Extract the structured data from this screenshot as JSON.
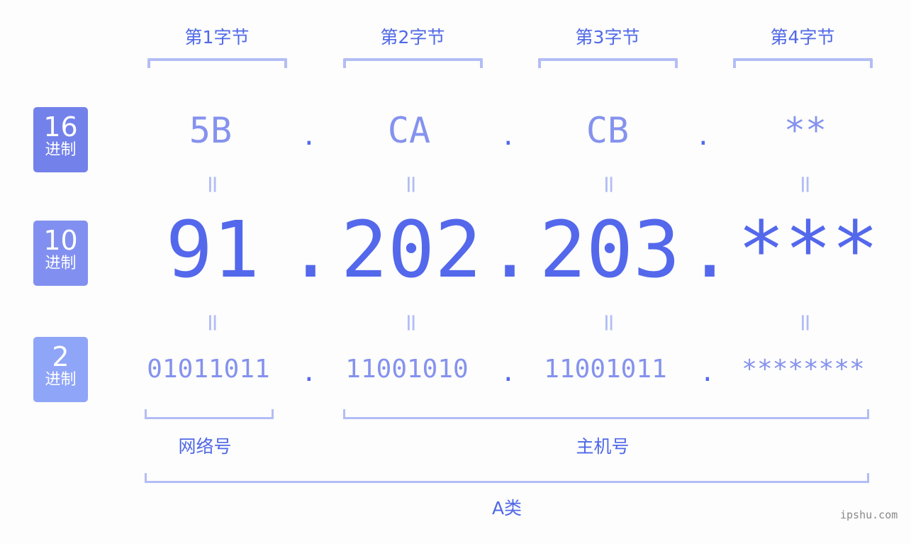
{
  "bytes": [
    {
      "label": "第1字节",
      "hex": "5B",
      "dec": "91",
      "bin": "01011011"
    },
    {
      "label": "第2字节",
      "hex": "CA",
      "dec": "202",
      "bin": "11001010"
    },
    {
      "label": "第3字节",
      "hex": "CB",
      "dec": "203",
      "bin": "11001011"
    },
    {
      "label": "第4字节",
      "hex": "**",
      "dec": "***",
      "bin": "********"
    }
  ],
  "separator": ".",
  "equals": "=",
  "badges": [
    {
      "num": "16",
      "unit": "进制",
      "color": "#7381ea"
    },
    {
      "num": "10",
      "unit": "进制",
      "color": "#8190f0"
    },
    {
      "num": "2",
      "unit": "进制",
      "color": "#8fa5f7"
    }
  ],
  "parts": {
    "network": "网络号",
    "host": "主机号"
  },
  "class_label": "A类",
  "watermark": "ipshu.com",
  "colors": {
    "accent": "#5468ec",
    "light": "#8592ee",
    "bracket": "#b3bdf5"
  }
}
